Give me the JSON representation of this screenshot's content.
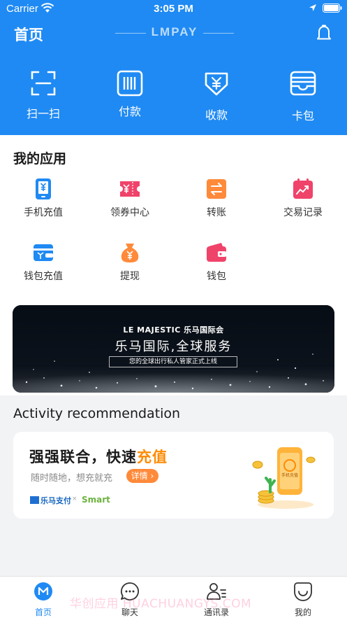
{
  "status_bar": {
    "carrier": "Carrier",
    "time": "3:05 PM"
  },
  "header": {
    "title": "首页",
    "brand": "LMPAY"
  },
  "quick_actions": [
    {
      "label": "扫一扫",
      "icon": "scan-icon"
    },
    {
      "label": "付款",
      "icon": "barcode-icon"
    },
    {
      "label": "收款",
      "icon": "yen-receive-icon"
    },
    {
      "label": "卡包",
      "icon": "card-wallet-icon"
    }
  ],
  "my_apps": {
    "title": "我的应用",
    "items": [
      {
        "label": "手机充值",
        "icon": "phone-recharge-icon",
        "color": "#1f8af3"
      },
      {
        "label": "领券中心",
        "icon": "coupon-icon",
        "color": "#f0436a"
      },
      {
        "label": "转账",
        "icon": "transfer-icon",
        "color": "#ff8a3a"
      },
      {
        "label": "交易记录",
        "icon": "transaction-record-icon",
        "color": "#f0436a"
      },
      {
        "label": "钱包充值",
        "icon": "wallet-recharge-icon",
        "color": "#1f8af3"
      },
      {
        "label": "提现",
        "icon": "money-bag-icon",
        "color": "#ff8a3a"
      },
      {
        "label": "钱包",
        "icon": "wallet-icon",
        "color": "#f0436a"
      }
    ]
  },
  "banner": {
    "logo_text": "LE MAJESTIC 乐马国际会",
    "title": "乐马国际,全球服务",
    "subtitle": "您的全球出行私人管家正式上线"
  },
  "activity": {
    "title": "Activity recommendation",
    "headline": "强强联合，快速",
    "headline_accent": "充值",
    "subline": "随时随地，想充就充",
    "button": "详情",
    "partner1": "乐马支付",
    "partner_sep": "×",
    "partner2": "Smart",
    "illustration_text": "手机充值"
  },
  "tabbar": [
    {
      "label": "首页",
      "icon": "home-m-icon",
      "active": true
    },
    {
      "label": "聊天",
      "icon": "chat-icon",
      "active": false
    },
    {
      "label": "通讯录",
      "icon": "contacts-icon",
      "active": false
    },
    {
      "label": "我的",
      "icon": "profile-smile-icon",
      "active": false
    }
  ],
  "watermark": "华创应用 HUACHUANGYS.COM",
  "colors": {
    "primary": "#1f8af3",
    "accent": "#ff8a00",
    "pink": "#f0436a",
    "orange": "#ff8a3a"
  }
}
